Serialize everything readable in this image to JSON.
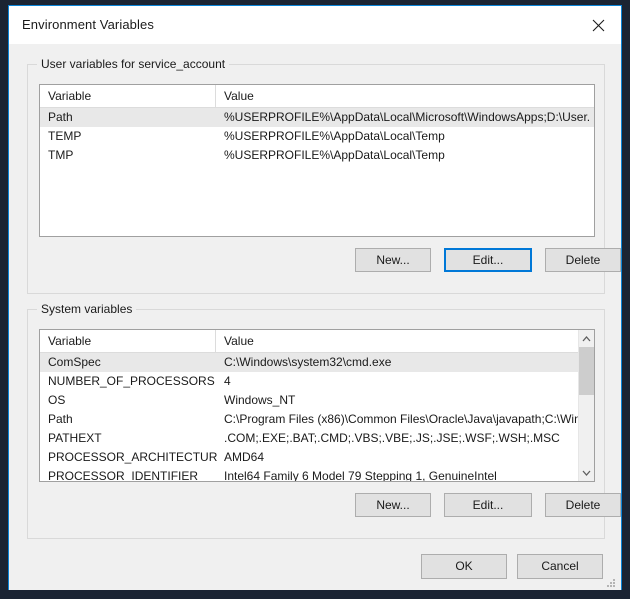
{
  "window": {
    "title": "Environment Variables",
    "close_icon": "close-icon",
    "border_color": "#0a84d8",
    "titlebar_bg": "#ffffff",
    "client_bg": "#f0f0f0"
  },
  "user_group": {
    "label": "User variables for service_account",
    "columns": [
      "Variable",
      "Value"
    ],
    "rows": [
      {
        "variable": "Path",
        "value": "%USERPROFILE%\\AppData\\Local\\Microsoft\\WindowsApps;D:\\User...",
        "selected": true
      },
      {
        "variable": "TEMP",
        "value": "%USERPROFILE%\\AppData\\Local\\Temp",
        "selected": false
      },
      {
        "variable": "TMP",
        "value": "%USERPROFILE%\\AppData\\Local\\Temp",
        "selected": false
      }
    ],
    "buttons": {
      "new": "New...",
      "edit": "Edit...",
      "delete": "Delete",
      "focused": "edit"
    }
  },
  "system_group": {
    "label": "System variables",
    "columns": [
      "Variable",
      "Value"
    ],
    "rows": [
      {
        "variable": "ComSpec",
        "value": "C:\\Windows\\system32\\cmd.exe",
        "selected": true
      },
      {
        "variable": "NUMBER_OF_PROCESSORS",
        "value": "4",
        "selected": false
      },
      {
        "variable": "OS",
        "value": "Windows_NT",
        "selected": false
      },
      {
        "variable": "Path",
        "value": "C:\\Program Files (x86)\\Common Files\\Oracle\\Java\\javapath;C:\\Win...",
        "selected": false
      },
      {
        "variable": "PATHEXT",
        "value": ".COM;.EXE;.BAT;.CMD;.VBS;.VBE;.JS;.JSE;.WSF;.WSH;.MSC",
        "selected": false
      },
      {
        "variable": "PROCESSOR_ARCHITECTURE",
        "value": "AMD64",
        "selected": false
      },
      {
        "variable": "PROCESSOR_IDENTIFIER",
        "value": "Intel64 Family 6 Model 79 Stepping 1, GenuineIntel",
        "selected": false
      }
    ],
    "buttons": {
      "new": "New...",
      "edit": "Edit...",
      "delete": "Delete",
      "focused": ""
    },
    "scrollbar": {
      "up_icon": "chevron-up-icon",
      "down_icon": "chevron-down-icon",
      "thumb_color": "#cdcdcd"
    }
  },
  "dialog_buttons": {
    "ok": "OK",
    "cancel": "Cancel"
  },
  "accent_color": "#0078d7",
  "selection_color": "#e8e8e8"
}
